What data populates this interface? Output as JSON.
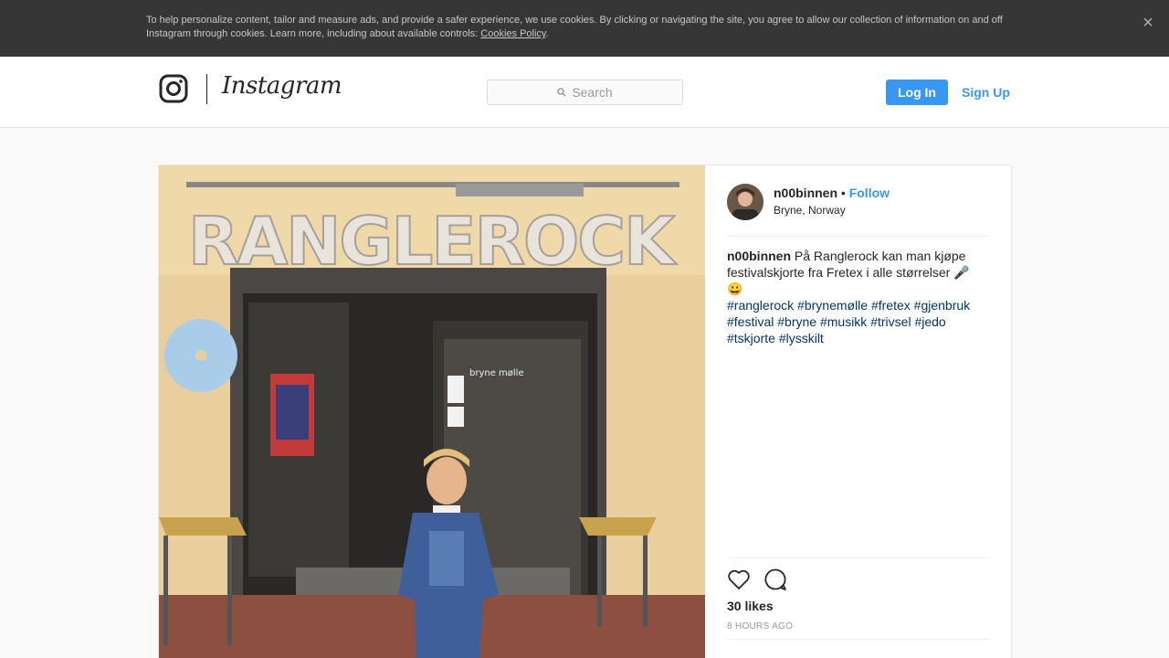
{
  "cookie_banner": {
    "text": "To help personalize content, tailor and measure ads, and provide a safer experience, we use cookies. By clicking or navigating the site, you agree to allow our collection of information on and off Instagram through cookies. Learn more, including about available controls: ",
    "link_text": "Cookies Policy",
    "trailing": ".",
    "close_icon": "close-icon"
  },
  "header": {
    "logo_text": "Instagram",
    "logo_icon": "instagram-camera-icon",
    "search_placeholder": "Search",
    "login_label": "Log In",
    "signup_label": "Sign Up"
  },
  "post": {
    "username": "n00binnen",
    "separator": "•",
    "follow_label": "Follow",
    "location": "Bryne, Norway",
    "caption_text": "På Ranglerock kan man kjøpe festivalskjorte fra Fretex i alle størrelser 🎤😀",
    "hashtags": [
      "#ranglerock",
      "#brynemølle",
      "#fretex",
      "#gjenbruk",
      "#festival",
      "#bryne",
      "#musikk",
      "#trivsel",
      "#jedo",
      "#tskjorte",
      "#lysskilt"
    ],
    "photo_sign_text": "RANGLEROCK",
    "photo_door_text": "bryne mølle",
    "likes": "30 likes",
    "time": "8 HOURS AGO"
  },
  "colors": {
    "accent": "#3897f0",
    "banner_bg": "#363636",
    "hashtag": "#003569"
  }
}
